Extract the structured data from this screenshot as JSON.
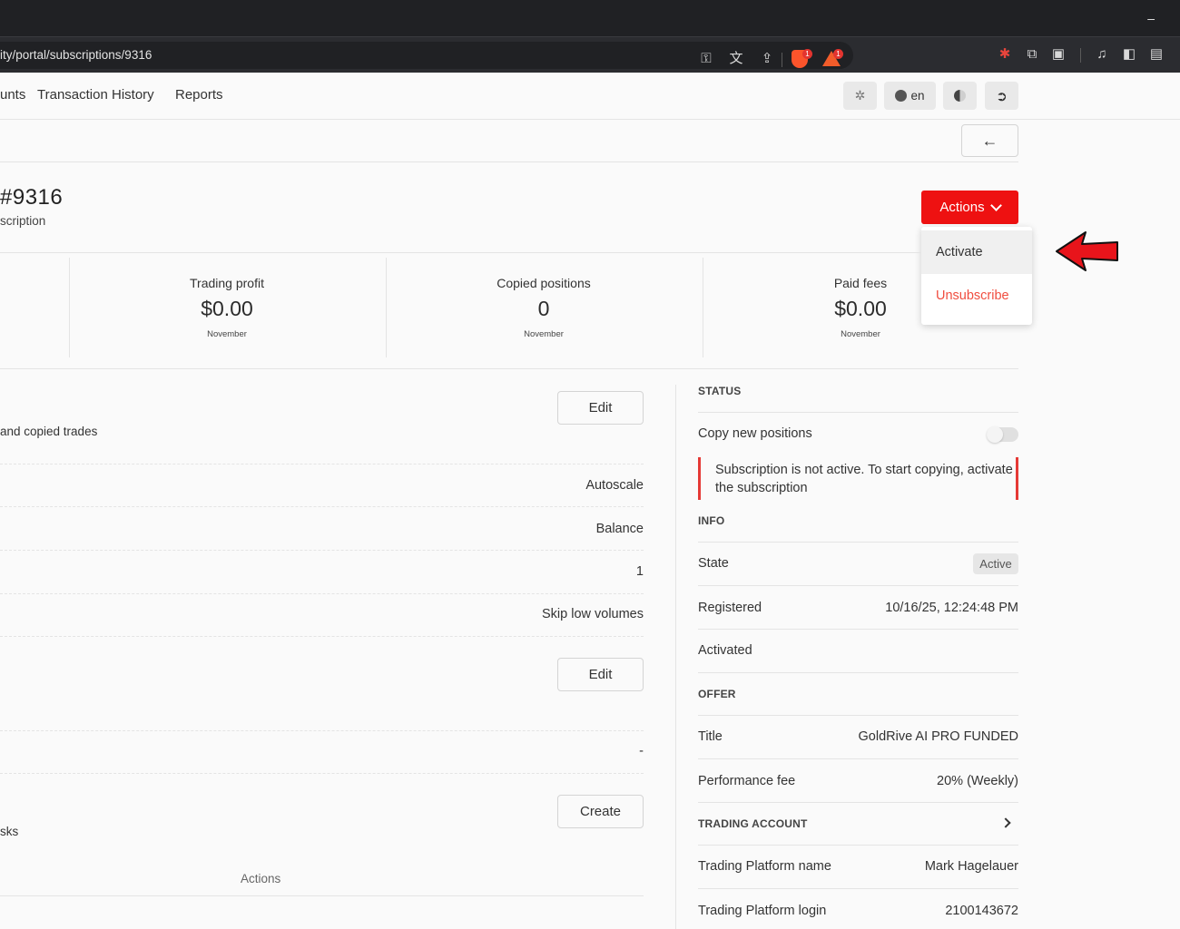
{
  "browser": {
    "url": "ity/portal/subscriptions/9316",
    "minimize_glyph": "–",
    "shield_badge": "1",
    "alert_badge": "1"
  },
  "nav": {
    "links": [
      "unts",
      "Transaction History",
      "Reports"
    ],
    "language": "en"
  },
  "header": {
    "title": "#9316",
    "subtitle": "scription",
    "actions_label": "Actions",
    "dropdown": {
      "activate": "Activate",
      "unsubscribe": "Unsubscribe"
    }
  },
  "stats": [
    {
      "label": "Trading profit",
      "value": "$0.00",
      "period": "November"
    },
    {
      "label": "Copied positions",
      "value": "0",
      "period": "November"
    },
    {
      "label": "Paid fees",
      "value": "$0.00",
      "period": "November"
    }
  ],
  "left": {
    "edit_label": "Edit",
    "edit2_label": "Edit",
    "create_label": "Create",
    "copied_trades_text": "and copied trades",
    "autoscale": "Autoscale",
    "balance": "Balance",
    "one": "1",
    "skip_low_volumes": "Skip low volumes",
    "dash": "-",
    "tasks_text": "sks",
    "actions_header": "Actions"
  },
  "status": {
    "section": "STATUS",
    "copy_new_positions": "Copy new positions",
    "alert": "Subscription is not active. To start copying, activate the subscription"
  },
  "info": {
    "section": "INFO",
    "state_label": "State",
    "state_value": "Active",
    "registered_label": "Registered",
    "registered_value": "10/16/25, 12:24:48 PM",
    "activated_label": "Activated"
  },
  "offer": {
    "section": "OFFER",
    "title_label": "Title",
    "title_value": "GoldRive AI PRO FUNDED",
    "fee_label": "Performance fee",
    "fee_value": "20% (Weekly)"
  },
  "trading_account": {
    "section": "TRADING ACCOUNT",
    "platform_name_label": "Trading Platform name",
    "platform_name_value": "Mark Hagelauer",
    "platform_login_label": "Trading Platform login",
    "platform_login_value": "2100143672"
  },
  "colors": {
    "accent": "#ee1111",
    "unsubscribe": "#f04d3f",
    "alert_border": "#e53935"
  }
}
